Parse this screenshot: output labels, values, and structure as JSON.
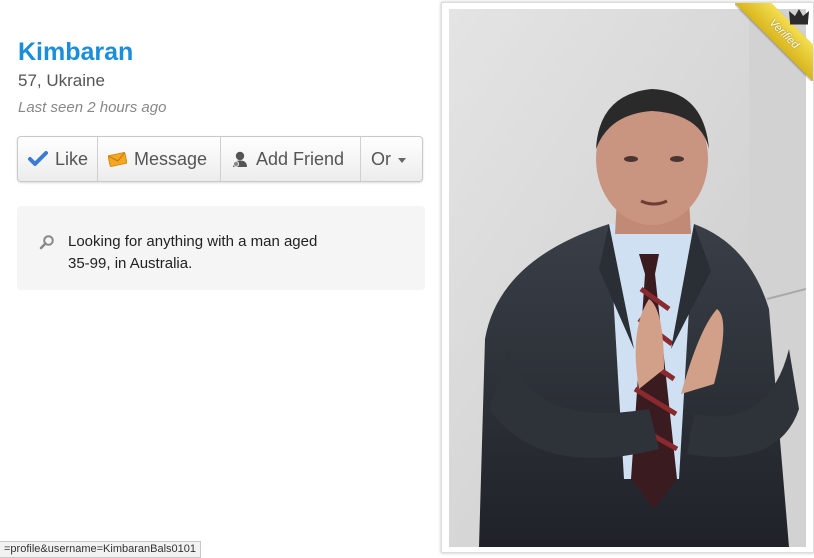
{
  "profile": {
    "name": "Kimbaran",
    "age_location": "57, Ukraine",
    "last_seen": "Last seen 2 hours ago"
  },
  "actions": {
    "like": "Like",
    "message": "Message",
    "add_friend": "Add Friend",
    "or": "Or"
  },
  "looking_for": {
    "text": "Looking for anything with a man aged 35-99, in Australia."
  },
  "photo": {
    "badge": "Verified"
  },
  "status_bar": {
    "url": "=profile&username=KimbaranBals0101"
  },
  "colors": {
    "name_blue": "#1a8ddb",
    "check_blue": "#3a7bd5",
    "envelope_orange": "#f5a623",
    "badge_gold": "#e8c93a"
  }
}
